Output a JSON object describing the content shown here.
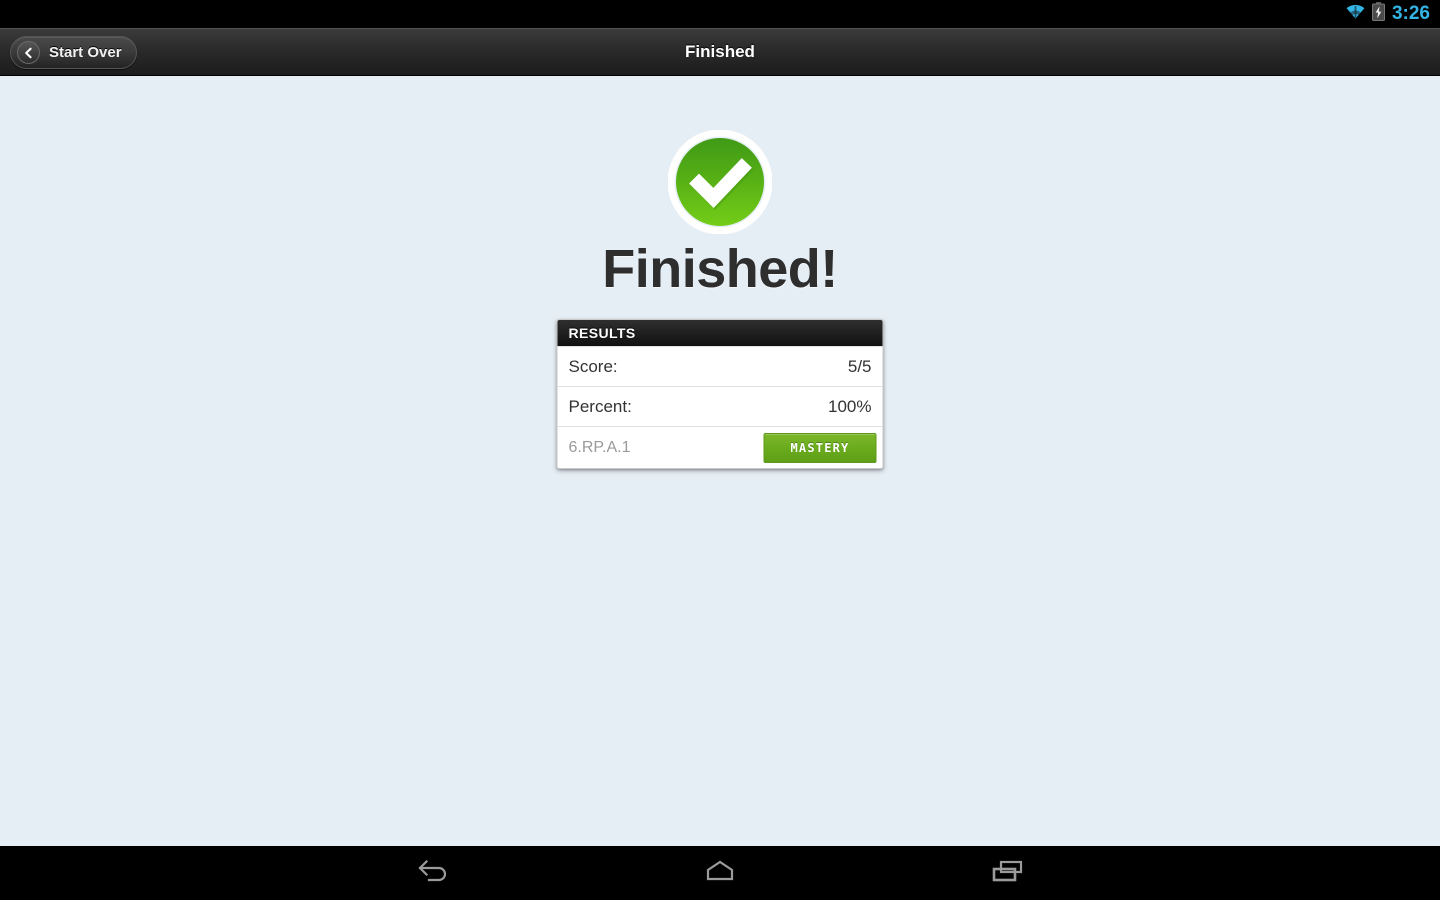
{
  "status_bar": {
    "time": "3:26",
    "wifi_icon": "wifi-icon",
    "battery_icon": "battery-charging-icon",
    "accent_color": "#33b5e5"
  },
  "action_bar": {
    "title": "Finished",
    "back_button_label": "Start Over",
    "back_icon": "chevron-left-icon"
  },
  "main": {
    "status_icon": "check-circle-icon",
    "heading": "Finished!",
    "card": {
      "header": "RESULTS",
      "rows": [
        {
          "label": "Score:",
          "value": "5/5"
        },
        {
          "label": "Percent:",
          "value": "100%"
        }
      ],
      "standard": {
        "code": "6.RP.A.1",
        "badge": "MASTERY",
        "badge_color": "#6aac1e"
      }
    }
  },
  "nav_bar": {
    "back": "back-icon",
    "home": "home-icon",
    "recents": "recents-icon"
  },
  "colors": {
    "background": "#e6eef5",
    "success_green": "#6dc614",
    "text_dark": "#2e2e2e"
  }
}
